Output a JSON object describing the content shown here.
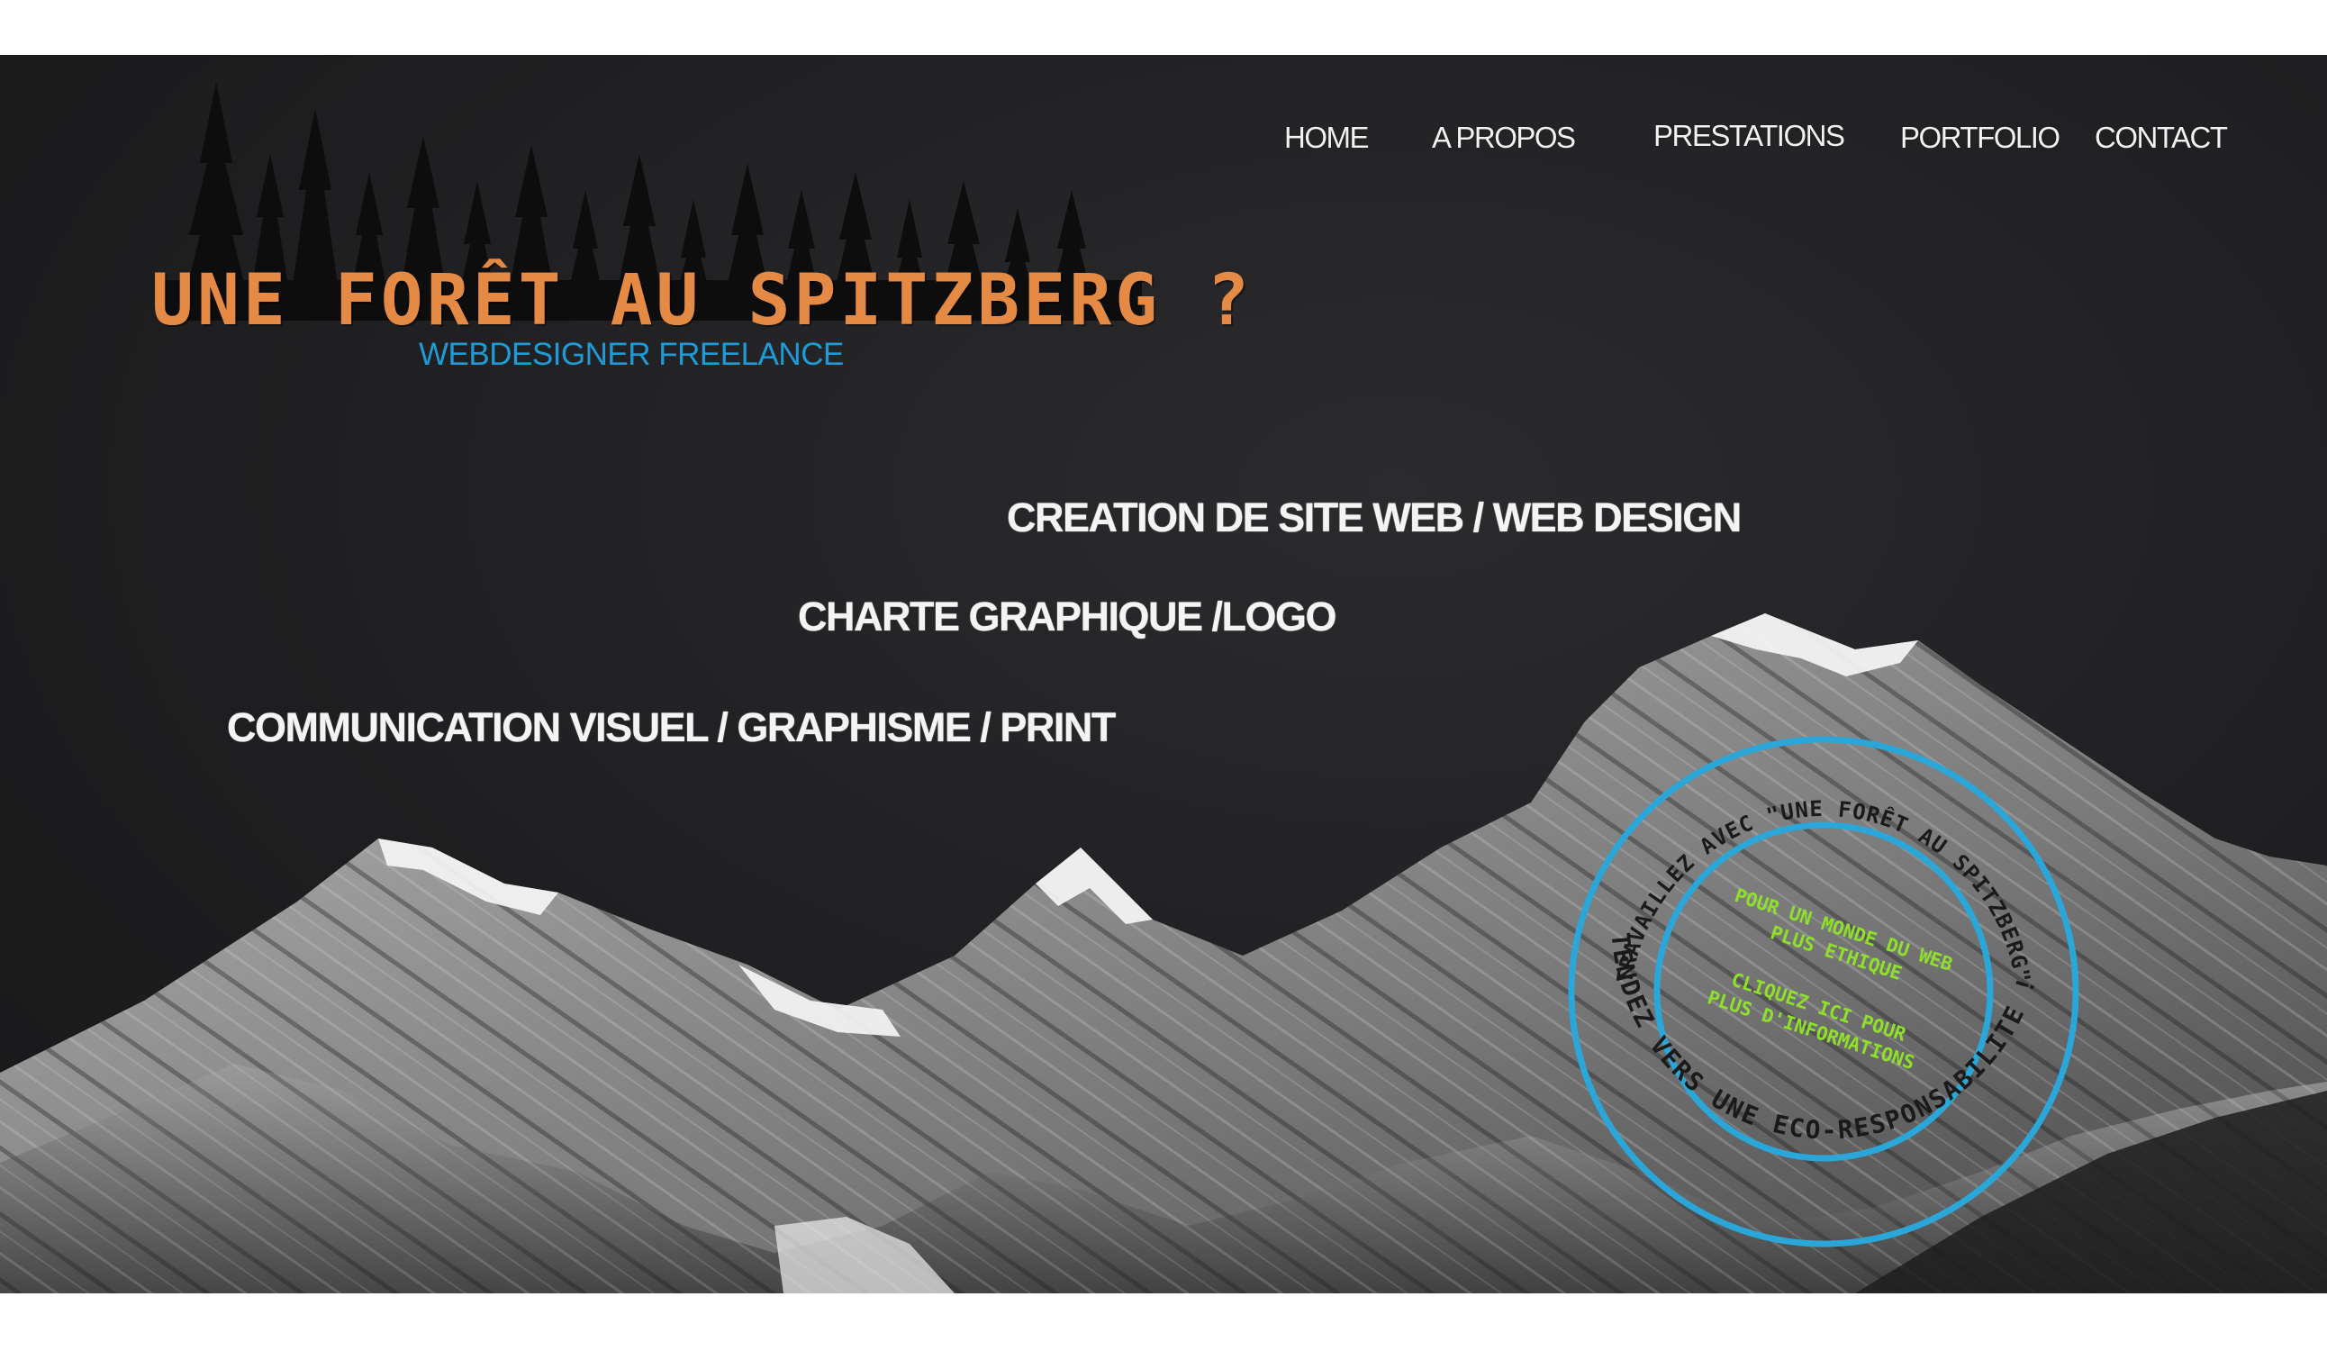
{
  "nav": {
    "home": "HOME",
    "apropos": "A PROPOS",
    "prestations": "PRESTATIONS",
    "portfolio": "PORTFOLIO",
    "contact": "CONTACT"
  },
  "logo": {
    "title": "UNE FORÊT AU SPITZBERG ?",
    "subtitle": "WEBDESIGNER FREELANCE"
  },
  "services": {
    "web": "CREATION DE SITE WEB / WEB DESIGN",
    "charte": "CHARTE GRAPHIQUE /LOGO",
    "communication": "COMMUNICATION VISUEL / GRAPHISME / PRINT"
  },
  "badge": {
    "outer_top": "TRAVAILLEZ AVEC \"UNE FORÊT AU SPITZBERG\"",
    "outer_bottom": "TENDEZ VERS UNE ECO-RESPONSABILITE !",
    "inner_line1": "POUR UN MONDE DU WEB",
    "inner_line2": "PLUS ETHIQUE",
    "inner_line3": "CLIQUEZ ICI POUR",
    "inner_line4": "PLUS D'INFORMATIONS"
  },
  "colors": {
    "background": "#1f1f21",
    "logo_orange": "#e58a45",
    "accent_blue": "#1e9ad6",
    "badge_green": "#8ee02a"
  }
}
